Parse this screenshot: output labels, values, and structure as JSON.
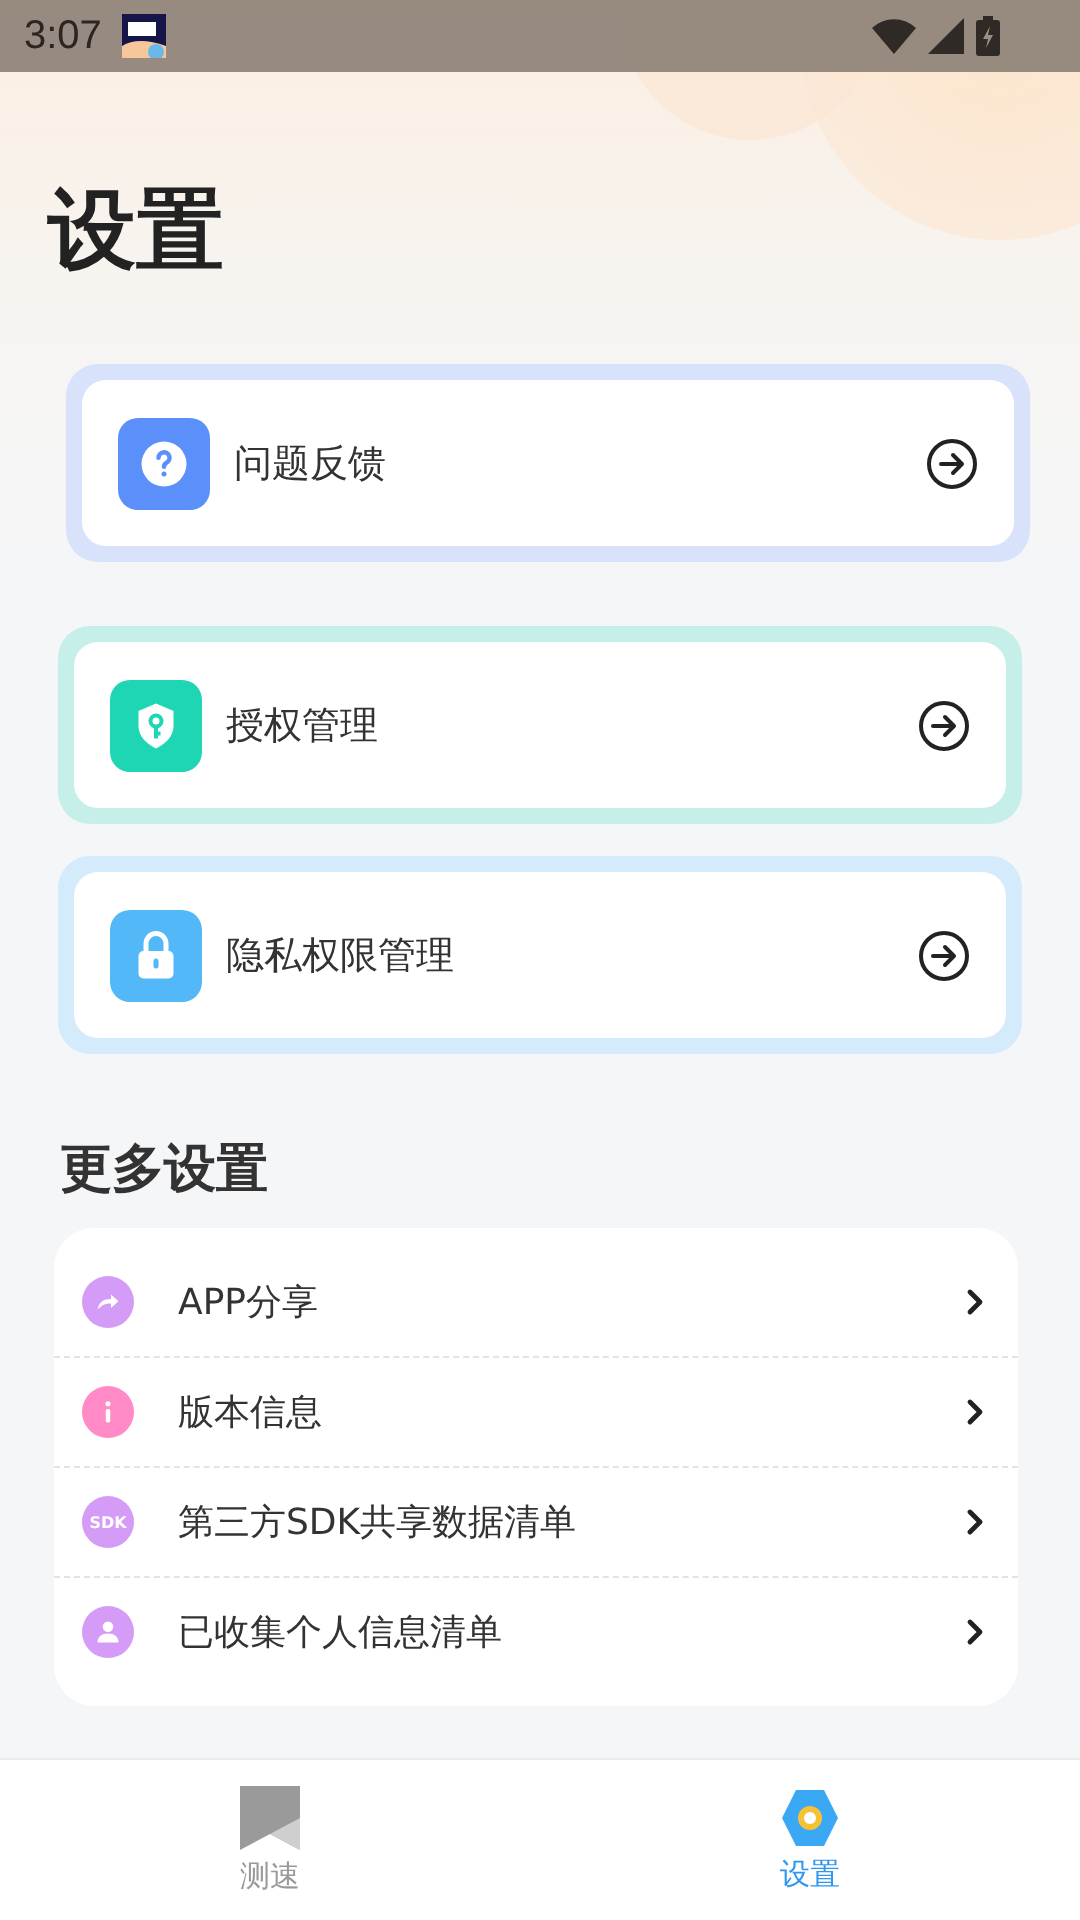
{
  "status_bar": {
    "time": "3:07"
  },
  "title": "设置",
  "cards": [
    {
      "kind": "feedback",
      "label": "问题反馈"
    },
    {
      "kind": "auth",
      "label": "授权管理"
    },
    {
      "kind": "privacy",
      "label": "隐私权限管理"
    }
  ],
  "more_section": {
    "heading": "更多设置",
    "items": [
      {
        "kind": "share",
        "label": "APP分享"
      },
      {
        "kind": "info",
        "label": "版本信息"
      },
      {
        "kind": "sdk",
        "badge": "SDK",
        "label": "第三方SDK共享数据清单"
      },
      {
        "kind": "person",
        "label": "已收集个人信息清单"
      }
    ]
  },
  "bottom_nav": [
    {
      "kind": "speed",
      "label": "测速",
      "selected": false
    },
    {
      "kind": "settings",
      "label": "设置",
      "selected": true
    }
  ]
}
